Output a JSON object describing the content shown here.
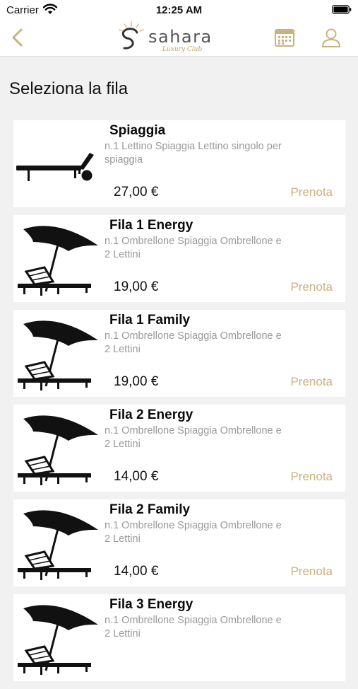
{
  "status": {
    "carrier": "Carrier",
    "time": "12:25 AM"
  },
  "nav": {
    "logo_text": "sahara",
    "logo_subtext": "Luxury Club",
    "accent_color": "#c9b27c"
  },
  "page": {
    "title": "Seleziona la fila"
  },
  "items": [
    {
      "image": "sunbed-icon",
      "title": "Spiaggia",
      "description": "n.1 Lettino Spiaggia Lettino singolo per spiaggia",
      "price": "27,00 €",
      "action": "Prenota"
    },
    {
      "image": "umbrella-sunbed-icon",
      "title": "Fila 1 Energy",
      "description": "n.1 Ombrellone Spiaggia Ombrellone e 2 Lettini",
      "price": "19,00 €",
      "action": "Prenota"
    },
    {
      "image": "umbrella-sunbed-icon",
      "title": "Fila 1 Family",
      "description": "n.1 Ombrellone Spiaggia Ombrellone e 2 Lettini",
      "price": "19,00 €",
      "action": "Prenota"
    },
    {
      "image": "umbrella-sunbed-icon",
      "title": "Fila 2 Energy",
      "description": "n.1 Ombrellone Spiaggia Ombrellone e 2 Lettini",
      "price": "14,00 €",
      "action": "Prenota"
    },
    {
      "image": "umbrella-sunbed-icon",
      "title": "Fila 2 Family",
      "description": "n.1 Ombrellone Spiaggia Ombrellone e 2 Lettini",
      "price": "14,00 €",
      "action": "Prenota"
    },
    {
      "image": "umbrella-sunbed-icon",
      "title": "Fila 3 Energy",
      "description": "n.1 Ombrellone Spiaggia Ombrellone e 2 Lettini",
      "price": "",
      "action": ""
    }
  ]
}
